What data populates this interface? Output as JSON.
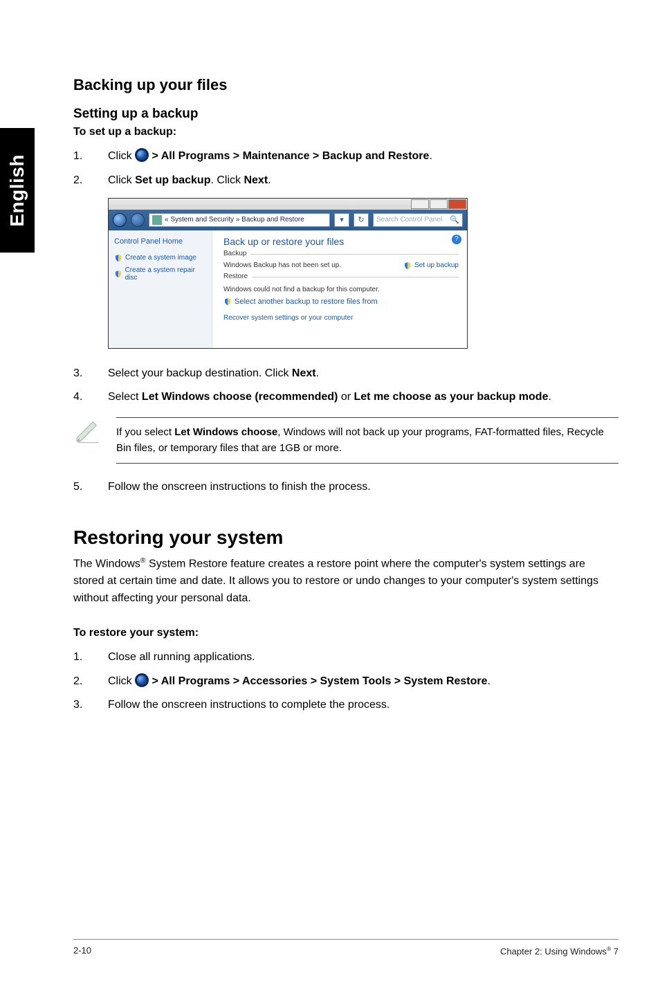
{
  "side_tab": "English",
  "h_backing": "Backing up your files",
  "h_setting": "Setting up a backup",
  "to_setup": "To set up a backup:",
  "steps_a": [
    {
      "n": "1.",
      "pre": "Click ",
      "menu": " > All Programs > Maintenance > Backup and Restore",
      "post": "."
    },
    {
      "n": "2.",
      "pre": "Click ",
      "b1": "Set up backup",
      "mid": ". Click ",
      "b2": "Next",
      "post": "."
    }
  ],
  "shot": {
    "crumb_prefix": "« System and Security » Backup and Restore",
    "search_placeholder": "Search Control Panel",
    "cp_home": "Control Panel Home",
    "left_links": [
      "Create a system image",
      "Create a system repair disc"
    ],
    "title": "Back up or restore your files",
    "backup_label": "Backup",
    "backup_msg": "Windows Backup has not been set up.",
    "setup_link": "Set up backup",
    "restore_label": "Restore",
    "restore_msg": "Windows could not find a backup for this computer.",
    "restore_link": "Select another backup to restore files from",
    "recover_link": "Recover system settings or your computer"
  },
  "steps_b": [
    {
      "n": "3.",
      "pre": "Select your backup destination. Click ",
      "b1": "Next",
      "post": "."
    },
    {
      "n": "4.",
      "pre": "Select ",
      "b1": "Let Windows choose (recommended)",
      "mid": " or ",
      "b2": "Let me choose as your backup mode",
      "post": "."
    }
  ],
  "note": {
    "pre": "If you select ",
    "b": "Let Windows choose",
    "post": ", Windows will not back up your programs, FAT-formatted files, Recycle Bin files, or temporary files that are 1GB or more."
  },
  "step5": {
    "n": "5.",
    "text": "Follow the onscreen instructions to finish the process."
  },
  "h_restoring": "Restoring your system",
  "restoring_desc_pre": "The Windows",
  "restoring_desc_post": " System Restore feature creates a restore point where the computer's system settings are stored at certain time and date. It allows you to restore or undo changes to your computer's system settings without affecting your personal data.",
  "to_restore": "To restore your system:",
  "steps_c": [
    {
      "n": "1.",
      "text": "Close all running applications."
    },
    {
      "n": "2.",
      "pre": "Click ",
      "menu": " > All Programs > Accessories > System Tools > System Restore",
      "post": "."
    },
    {
      "n": "3.",
      "text": "Follow the onscreen instructions to complete the process."
    }
  ],
  "footer_left": "2-10",
  "footer_right_pre": "Chapter 2: Using Windows",
  "footer_right_post": " 7"
}
